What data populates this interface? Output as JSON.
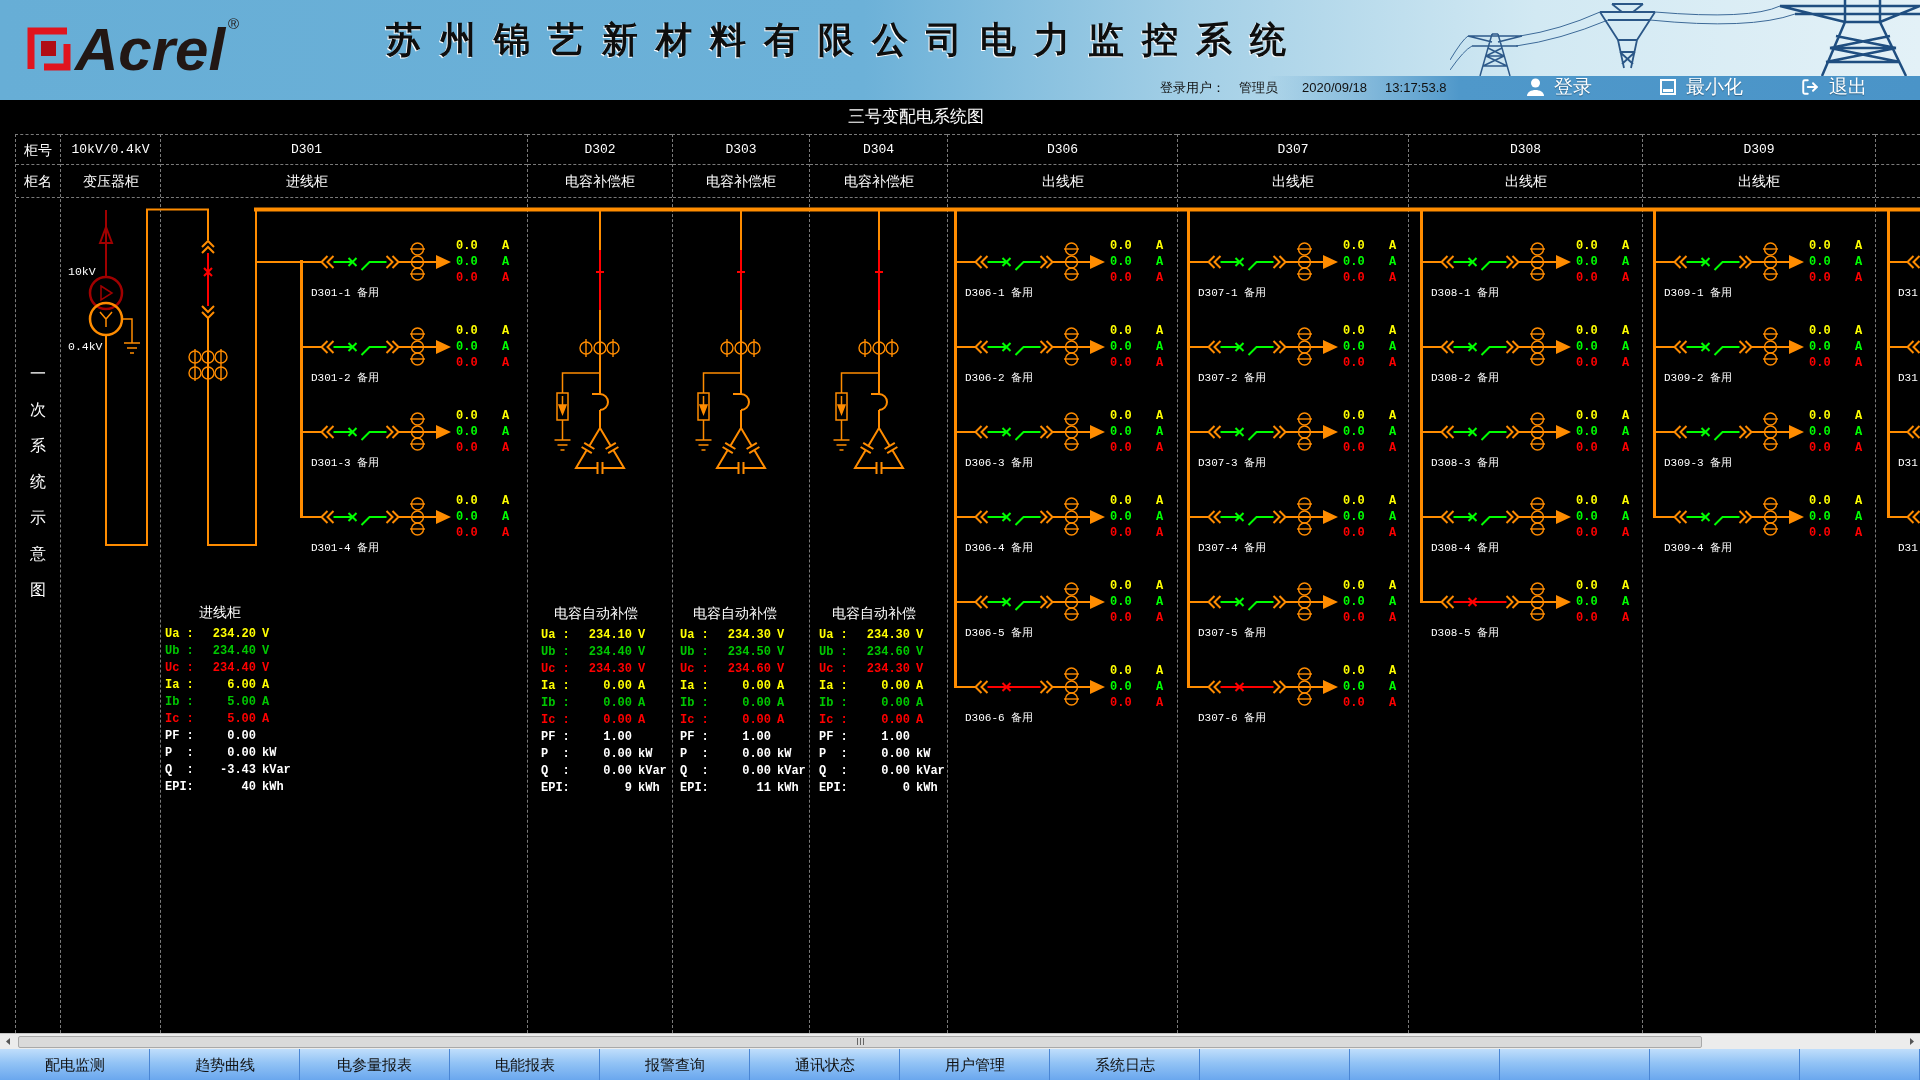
{
  "header": {
    "logo": "Acrel",
    "logo_mark": "®",
    "title": "苏州锦艺新材料有限公司电力监控系统",
    "user_label": "登录用户：",
    "user": "管理员",
    "date": "2020/09/18",
    "time": "13:17:53.8",
    "buttons": [
      {
        "kind": "login",
        "label": "登录"
      },
      {
        "kind": "minimize",
        "label": "最小化"
      },
      {
        "kind": "exit",
        "label": "退出"
      }
    ]
  },
  "diagram": {
    "title": "三号变配电系统图",
    "row_headers": {
      "number": "柜号",
      "name": "柜名"
    },
    "side_label": "一次系统示意图",
    "cabinets": [
      {
        "kind": "transformer",
        "number": "10kV/0.4kV",
        "name": "变压器柜",
        "hv_label": "10kV",
        "lv_label": "0.4kV"
      },
      {
        "kind": "incoming",
        "number": "D301",
        "name": "进线柜",
        "breaker_closed": true,
        "feeders": [
          {
            "label": "D301-1 备用",
            "breaker_closed": false,
            "readings": [
              {
                "value": "0.0",
                "unit": "A",
                "color": "#ffff00"
              },
              {
                "value": "0.0",
                "unit": "A",
                "color": "#00ff00"
              },
              {
                "value": "0.0",
                "unit": "A",
                "color": "#ff0000"
              }
            ]
          },
          {
            "label": "D301-2 备用",
            "breaker_closed": false,
            "readings": [
              {
                "value": "0.0",
                "unit": "A",
                "color": "#ffff00"
              },
              {
                "value": "0.0",
                "unit": "A",
                "color": "#00ff00"
              },
              {
                "value": "0.0",
                "unit": "A",
                "color": "#ff0000"
              }
            ]
          },
          {
            "label": "D301-3 备用",
            "breaker_closed": false,
            "readings": [
              {
                "value": "0.0",
                "unit": "A",
                "color": "#ffff00"
              },
              {
                "value": "0.0",
                "unit": "A",
                "color": "#00ff00"
              },
              {
                "value": "0.0",
                "unit": "A",
                "color": "#ff0000"
              }
            ]
          },
          {
            "label": "D301-4 备用",
            "breaker_closed": false,
            "readings": [
              {
                "value": "0.0",
                "unit": "A",
                "color": "#ffff00"
              },
              {
                "value": "0.0",
                "unit": "A",
                "color": "#00ff00"
              },
              {
                "value": "0.0",
                "unit": "A",
                "color": "#ff0000"
              }
            ]
          }
        ],
        "meter": {
          "title": "进线柜",
          "rows": [
            {
              "label": "Ua :",
              "value": "234.20",
              "unit": "V",
              "color": "#ffff00"
            },
            {
              "label": "Ub :",
              "value": "234.40",
              "unit": "V",
              "color": "#00c800"
            },
            {
              "label": "Uc :",
              "value": "234.40",
              "unit": "V",
              "color": "#ff0000"
            },
            {
              "label": "Ia :",
              "value": "6.00",
              "unit": "A",
              "color": "#ffff00"
            },
            {
              "label": "Ib :",
              "value": "5.00",
              "unit": "A",
              "color": "#00c800"
            },
            {
              "label": "Ic :",
              "value": "5.00",
              "unit": "A",
              "color": "#ff0000"
            },
            {
              "label": "PF :",
              "value": "0.00",
              "color": "#ffffff"
            },
            {
              "label": "P  :",
              "value": "0.00",
              "unit": "kW",
              "color": "#ffffff"
            },
            {
              "label": "Q  :",
              "value": "-3.43",
              "unit": "kVar",
              "color": "#ffffff"
            },
            {
              "label": "EPI:",
              "value": "40",
              "unit": "kWh",
              "color": "#ffffff"
            }
          ]
        }
      },
      {
        "kind": "capacitor",
        "number": "D302",
        "name": "电容补偿柜",
        "breaker_closed": true,
        "meter": {
          "title": "电容自动补偿",
          "rows": [
            {
              "label": "Ua :",
              "value": "234.10",
              "unit": "V",
              "color": "#ffff00"
            },
            {
              "label": "Ub :",
              "value": "234.40",
              "unit": "V",
              "color": "#00c800"
            },
            {
              "label": "Uc :",
              "value": "234.30",
              "unit": "V",
              "color": "#ff0000"
            },
            {
              "label": "Ia :",
              "value": "0.00",
              "unit": "A",
              "color": "#ffff00"
            },
            {
              "label": "Ib :",
              "value": "0.00",
              "unit": "A",
              "color": "#00c800"
            },
            {
              "label": "Ic :",
              "value": "0.00",
              "unit": "A",
              "color": "#ff0000"
            },
            {
              "label": "PF :",
              "value": "1.00",
              "color": "#ffffff"
            },
            {
              "label": "P  :",
              "value": "0.00",
              "unit": "kW",
              "color": "#ffffff"
            },
            {
              "label": "Q  :",
              "value": "0.00",
              "unit": "kVar",
              "color": "#ffffff"
            },
            {
              "label": "EPI:",
              "value": "9",
              "unit": "kWh",
              "color": "#ffffff"
            }
          ]
        }
      },
      {
        "kind": "capacitor",
        "number": "D303",
        "name": "电容补偿柜",
        "breaker_closed": true,
        "meter": {
          "title": "电容自动补偿",
          "rows": [
            {
              "label": "Ua :",
              "value": "234.30",
              "unit": "V",
              "color": "#ffff00"
            },
            {
              "label": "Ub :",
              "value": "234.50",
              "unit": "V",
              "color": "#00c800"
            },
            {
              "label": "Uc :",
              "value": "234.60",
              "unit": "V",
              "color": "#ff0000"
            },
            {
              "label": "Ia :",
              "value": "0.00",
              "unit": "A",
              "color": "#ffff00"
            },
            {
              "label": "Ib :",
              "value": "0.00",
              "unit": "A",
              "color": "#00c800"
            },
            {
              "label": "Ic :",
              "value": "0.00",
              "unit": "A",
              "color": "#ff0000"
            },
            {
              "label": "PF :",
              "value": "1.00",
              "color": "#ffffff"
            },
            {
              "label": "P  :",
              "value": "0.00",
              "unit": "kW",
              "color": "#ffffff"
            },
            {
              "label": "Q  :",
              "value": "0.00",
              "unit": "kVar",
              "color": "#ffffff"
            },
            {
              "label": "EPI:",
              "value": "11",
              "unit": "kWh",
              "color": "#ffffff"
            }
          ]
        }
      },
      {
        "kind": "capacitor",
        "number": "D304",
        "name": "电容补偿柜",
        "breaker_closed": true,
        "meter": {
          "title": "电容自动补偿",
          "rows": [
            {
              "label": "Ua :",
              "value": "234.30",
              "unit": "V",
              "color": "#ffff00"
            },
            {
              "label": "Ub :",
              "value": "234.60",
              "unit": "V",
              "color": "#00c800"
            },
            {
              "label": "Uc :",
              "value": "234.30",
              "unit": "V",
              "color": "#ff0000"
            },
            {
              "label": "Ia :",
              "value": "0.00",
              "unit": "A",
              "color": "#ffff00"
            },
            {
              "label": "Ib :",
              "value": "0.00",
              "unit": "A",
              "color": "#00c800"
            },
            {
              "label": "Ic :",
              "value": "0.00",
              "unit": "A",
              "color": "#ff0000"
            },
            {
              "label": "PF :",
              "value": "1.00",
              "color": "#ffffff"
            },
            {
              "label": "P  :",
              "value": "0.00",
              "unit": "kW",
              "color": "#ffffff"
            },
            {
              "label": "Q  :",
              "value": "0.00",
              "unit": "kVar",
              "color": "#ffffff"
            },
            {
              "label": "EPI:",
              "value": "0",
              "unit": "kWh",
              "color": "#ffffff"
            }
          ]
        }
      },
      {
        "kind": "outgoing",
        "number": "D306",
        "name": "出线柜",
        "feeders": [
          {
            "label": "D306-1 备用",
            "breaker_closed": false,
            "readings": [
              {
                "value": "0.0",
                "unit": "A",
                "color": "#ffff00"
              },
              {
                "value": "0.0",
                "unit": "A",
                "color": "#00ff00"
              },
              {
                "value": "0.0",
                "unit": "A",
                "color": "#ff0000"
              }
            ]
          },
          {
            "label": "D306-2 备用",
            "breaker_closed": false,
            "readings": [
              {
                "value": "0.0",
                "unit": "A",
                "color": "#ffff00"
              },
              {
                "value": "0.0",
                "unit": "A",
                "color": "#00ff00"
              },
              {
                "value": "0.0",
                "unit": "A",
                "color": "#ff0000"
              }
            ]
          },
          {
            "label": "D306-3 备用",
            "breaker_closed": false,
            "readings": [
              {
                "value": "0.0",
                "unit": "A",
                "color": "#ffff00"
              },
              {
                "value": "0.0",
                "unit": "A",
                "color": "#00ff00"
              },
              {
                "value": "0.0",
                "unit": "A",
                "color": "#ff0000"
              }
            ]
          },
          {
            "label": "D306-4 备用",
            "breaker_closed": false,
            "readings": [
              {
                "value": "0.0",
                "unit": "A",
                "color": "#ffff00"
              },
              {
                "value": "0.0",
                "unit": "A",
                "color": "#00ff00"
              },
              {
                "value": "0.0",
                "unit": "A",
                "color": "#ff0000"
              }
            ]
          },
          {
            "label": "D306-5 备用",
            "breaker_closed": false,
            "readings": [
              {
                "value": "0.0",
                "unit": "A",
                "color": "#ffff00"
              },
              {
                "value": "0.0",
                "unit": "A",
                "color": "#00ff00"
              },
              {
                "value": "0.0",
                "unit": "A",
                "color": "#ff0000"
              }
            ]
          },
          {
            "label": "D306-6 备用",
            "breaker_closed": true,
            "readings": [
              {
                "value": "0.0",
                "unit": "A",
                "color": "#ffff00"
              },
              {
                "value": "0.0",
                "unit": "A",
                "color": "#00ff00"
              },
              {
                "value": "0.0",
                "unit": "A",
                "color": "#ff0000"
              }
            ]
          }
        ]
      },
      {
        "kind": "outgoing",
        "number": "D307",
        "name": "出线柜",
        "feeders": [
          {
            "label": "D307-1 备用",
            "breaker_closed": false,
            "readings": [
              {
                "value": "0.0",
                "unit": "A",
                "color": "#ffff00"
              },
              {
                "value": "0.0",
                "unit": "A",
                "color": "#00ff00"
              },
              {
                "value": "0.0",
                "unit": "A",
                "color": "#ff0000"
              }
            ]
          },
          {
            "label": "D307-2 备用",
            "breaker_closed": false,
            "readings": [
              {
                "value": "0.0",
                "unit": "A",
                "color": "#ffff00"
              },
              {
                "value": "0.0",
                "unit": "A",
                "color": "#00ff00"
              },
              {
                "value": "0.0",
                "unit": "A",
                "color": "#ff0000"
              }
            ]
          },
          {
            "label": "D307-3 备用",
            "breaker_closed": false,
            "readings": [
              {
                "value": "0.0",
                "unit": "A",
                "color": "#ffff00"
              },
              {
                "value": "0.0",
                "unit": "A",
                "color": "#00ff00"
              },
              {
                "value": "0.0",
                "unit": "A",
                "color": "#ff0000"
              }
            ]
          },
          {
            "label": "D307-4 备用",
            "breaker_closed": false,
            "readings": [
              {
                "value": "0.0",
                "unit": "A",
                "color": "#ffff00"
              },
              {
                "value": "0.0",
                "unit": "A",
                "color": "#00ff00"
              },
              {
                "value": "0.0",
                "unit": "A",
                "color": "#ff0000"
              }
            ]
          },
          {
            "label": "D307-5 备用",
            "breaker_closed": false,
            "readings": [
              {
                "value": "0.0",
                "unit": "A",
                "color": "#ffff00"
              },
              {
                "value": "0.0",
                "unit": "A",
                "color": "#00ff00"
              },
              {
                "value": "0.0",
                "unit": "A",
                "color": "#ff0000"
              }
            ]
          },
          {
            "label": "D307-6 备用",
            "breaker_closed": true,
            "readings": [
              {
                "value": "0.0",
                "unit": "A",
                "color": "#ffff00"
              },
              {
                "value": "0.0",
                "unit": "A",
                "color": "#00ff00"
              },
              {
                "value": "0.0",
                "unit": "A",
                "color": "#ff0000"
              }
            ]
          }
        ]
      },
      {
        "kind": "outgoing",
        "number": "D308",
        "name": "出线柜",
        "feeders": [
          {
            "label": "D308-1 备用",
            "breaker_closed": false,
            "readings": [
              {
                "value": "0.0",
                "unit": "A",
                "color": "#ffff00"
              },
              {
                "value": "0.0",
                "unit": "A",
                "color": "#00ff00"
              },
              {
                "value": "0.0",
                "unit": "A",
                "color": "#ff0000"
              }
            ]
          },
          {
            "label": "D308-2 备用",
            "breaker_closed": false,
            "readings": [
              {
                "value": "0.0",
                "unit": "A",
                "color": "#ffff00"
              },
              {
                "value": "0.0",
                "unit": "A",
                "color": "#00ff00"
              },
              {
                "value": "0.0",
                "unit": "A",
                "color": "#ff0000"
              }
            ]
          },
          {
            "label": "D308-3 备用",
            "breaker_closed": false,
            "readings": [
              {
                "value": "0.0",
                "unit": "A",
                "color": "#ffff00"
              },
              {
                "value": "0.0",
                "unit": "A",
                "color": "#00ff00"
              },
              {
                "value": "0.0",
                "unit": "A",
                "color": "#ff0000"
              }
            ]
          },
          {
            "label": "D308-4 备用",
            "breaker_closed": false,
            "readings": [
              {
                "value": "0.0",
                "unit": "A",
                "color": "#ffff00"
              },
              {
                "value": "0.0",
                "unit": "A",
                "color": "#00ff00"
              },
              {
                "value": "0.0",
                "unit": "A",
                "color": "#ff0000"
              }
            ]
          },
          {
            "label": "D308-5 备用",
            "breaker_closed": true,
            "readings": [
              {
                "value": "0.0",
                "unit": "A",
                "color": "#ffff00"
              },
              {
                "value": "0.0",
                "unit": "A",
                "color": "#00ff00"
              },
              {
                "value": "0.0",
                "unit": "A",
                "color": "#ff0000"
              }
            ]
          }
        ]
      },
      {
        "kind": "outgoing",
        "number": "D309",
        "name": "出线柜",
        "feeders": [
          {
            "label": "D309-1 备用",
            "breaker_closed": false,
            "readings": [
              {
                "value": "0.0",
                "unit": "A",
                "color": "#ffff00"
              },
              {
                "value": "0.0",
                "unit": "A",
                "color": "#00ff00"
              },
              {
                "value": "0.0",
                "unit": "A",
                "color": "#ff0000"
              }
            ]
          },
          {
            "label": "D309-2 备用",
            "breaker_closed": false,
            "readings": [
              {
                "value": "0.0",
                "unit": "A",
                "color": "#ffff00"
              },
              {
                "value": "0.0",
                "unit": "A",
                "color": "#00ff00"
              },
              {
                "value": "0.0",
                "unit": "A",
                "color": "#ff0000"
              }
            ]
          },
          {
            "label": "D309-3 备用",
            "breaker_closed": false,
            "readings": [
              {
                "value": "0.0",
                "unit": "A",
                "color": "#ffff00"
              },
              {
                "value": "0.0",
                "unit": "A",
                "color": "#00ff00"
              },
              {
                "value": "0.0",
                "unit": "A",
                "color": "#ff0000"
              }
            ]
          },
          {
            "label": "D309-4 备用",
            "breaker_closed": false,
            "readings": [
              {
                "value": "0.0",
                "unit": "A",
                "color": "#ffff00"
              },
              {
                "value": "0.0",
                "unit": "A",
                "color": "#00ff00"
              },
              {
                "value": "0.0",
                "unit": "A",
                "color": "#ff0000"
              }
            ]
          }
        ]
      },
      {
        "kind": "edge",
        "feeders": [
          {
            "label": "D31"
          },
          {
            "label": "D31"
          },
          {
            "label": "D31"
          },
          {
            "label": "D31"
          }
        ]
      }
    ]
  },
  "tabs": [
    {
      "label": "配电监测"
    },
    {
      "label": "趋势曲线"
    },
    {
      "label": "电参量报表"
    },
    {
      "label": "电能报表"
    },
    {
      "label": "报警查询"
    },
    {
      "label": "通讯状态"
    },
    {
      "label": "用户管理"
    },
    {
      "label": "系统日志"
    }
  ]
}
